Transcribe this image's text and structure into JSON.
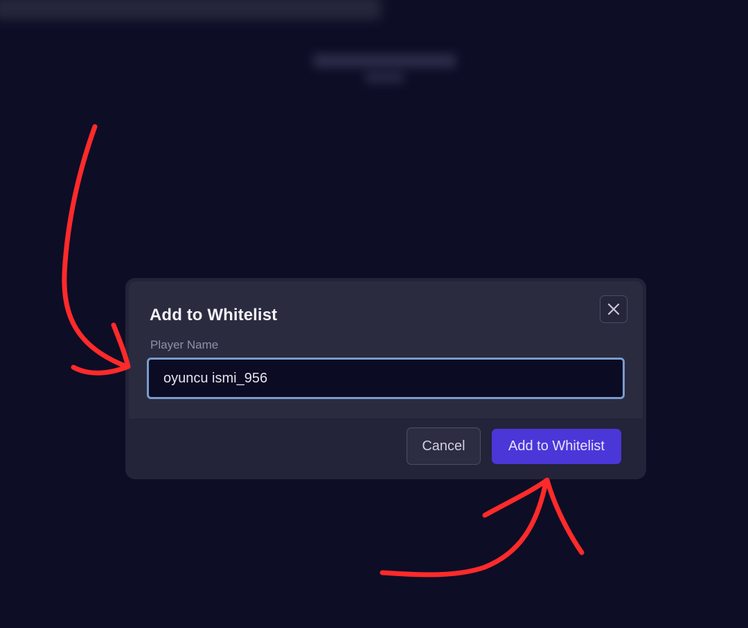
{
  "dialog": {
    "title": "Add to Whitelist",
    "field_label": "Player Name",
    "player_name_value": "oyuncu ismi_956",
    "cancel_label": "Cancel",
    "submit_label": "Add to Whitelist",
    "close_icon": "close-icon"
  },
  "colors": {
    "background": "#0d0d26",
    "dialog_body": "#2b2b40",
    "dialog_footer": "#232339",
    "input_focus_border": "#7a9ccc",
    "primary_button": "#4b36d8",
    "annotation_arrows": "#ff2a2a"
  },
  "annotations": {
    "arrow_icons": [
      "arrow-pointing-to-input-icon",
      "arrow-pointing-to-submit-icon"
    ]
  }
}
